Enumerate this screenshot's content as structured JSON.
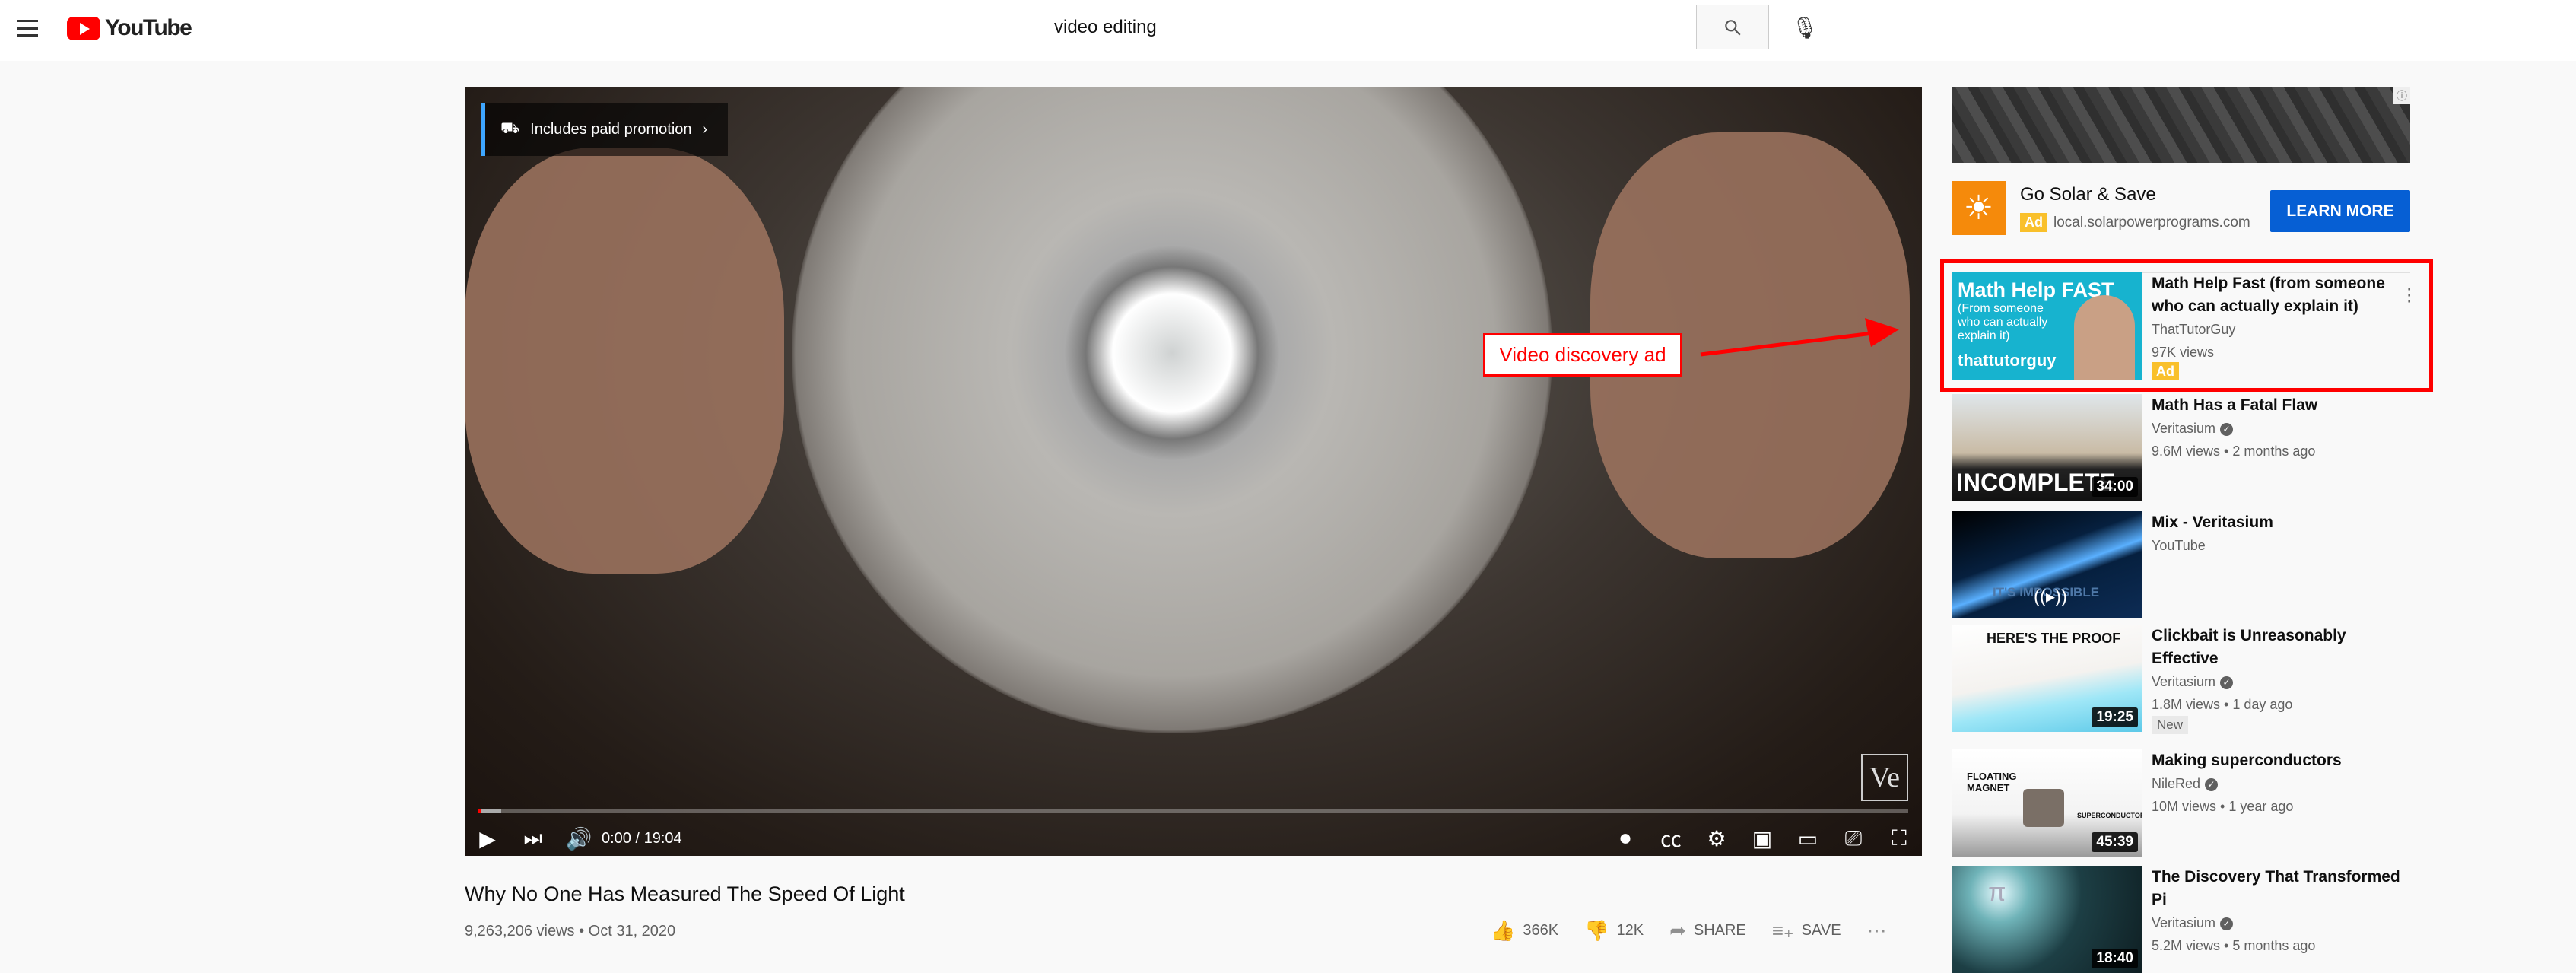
{
  "header": {
    "logo_text": "YouTube",
    "search_value": "video editing"
  },
  "player": {
    "promo": "Includes paid promotion",
    "time": "0:00 / 19:04",
    "watermark": "Ve",
    "progress_percent": 0
  },
  "video": {
    "title": "Why No One Has Measured The Speed Of Light",
    "meta": "9,263,206 views • Oct 31, 2020",
    "likes": "366K",
    "dislikes": "12K",
    "share": "SHARE",
    "save": "SAVE"
  },
  "ad": {
    "title": "Go Solar & Save",
    "badge": "Ad",
    "domain": "local.solarpowerprograms.com",
    "cta": "LEARN MORE"
  },
  "annotation": {
    "label": "Video discovery ad",
    "color": "#ff0000"
  },
  "sidebar": [
    {
      "title": "Math Help Fast (from someone who can actually explain it)",
      "channel": "ThatTutorGuy",
      "views": "97K views",
      "badge": "Ad",
      "thumb_text": "Math Help FAST",
      "thumb_sub": "(From someone who can actually explain it)",
      "thumb_brand": "thattutorguy"
    },
    {
      "title": "Math Has a Fatal Flaw",
      "channel": "Veritasium",
      "views": "9.6M views • 2 months ago",
      "duration": "34:00",
      "thumb_text": "INCOMPLETE"
    },
    {
      "title": "Mix - Veritasium",
      "channel": "YouTube",
      "thumb_text": "IT'S IMPOSSIBLE"
    },
    {
      "title": "Clickbait is Unreasonably Effective",
      "channel": "Veritasium",
      "views": "1.8M views • 1 day ago",
      "badge": "New",
      "duration": "19:25",
      "thumb_text": "HERE'S THE PROOF"
    },
    {
      "title": "Making superconductors",
      "channel": "NileRed",
      "views": "10M views • 1 year ago",
      "duration": "45:39",
      "thumb_text": "FLOATING MAGNET",
      "thumb_sub": "SUPERCONDUCTOR"
    },
    {
      "title": "The Discovery That Transformed Pi",
      "channel": "Veritasium",
      "views": "5.2M views • 5 months ago",
      "duration": "18:40",
      "thumb_text": "π"
    }
  ]
}
